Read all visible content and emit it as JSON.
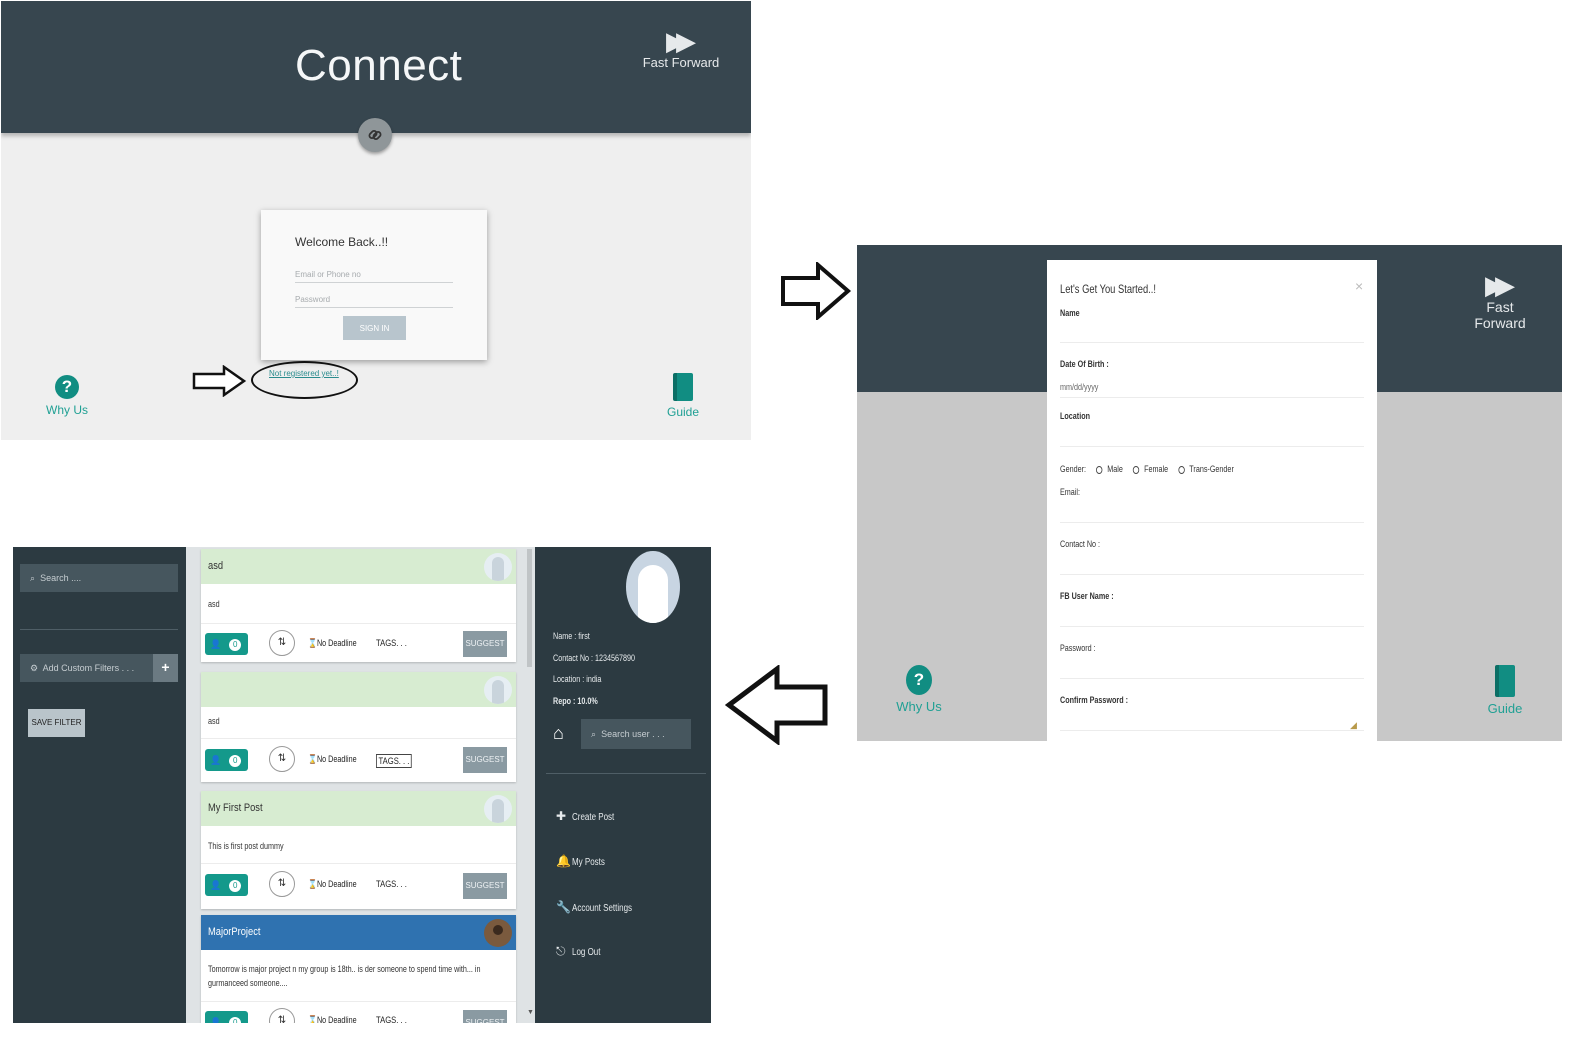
{
  "login": {
    "brand": "Connect",
    "fast_forward": "Fast Forward",
    "welcome": "Welcome Back..!!",
    "email_placeholder": "Email or Phone no",
    "password_placeholder": "Password",
    "signin": "SIGN IN",
    "not_registered": "Not registered yet..!",
    "why_us": "Why Us",
    "guide": "Guide"
  },
  "register": {
    "fast_forward": "Fast Forward",
    "why_us": "Why Us",
    "guide": "Guide",
    "title": "Let's Get You Started..!",
    "close": "×",
    "fields": {
      "name": "Name",
      "dob": "Date Of Birth :",
      "dob_value": "mm/dd/yyyy",
      "location": "Location",
      "gender": "Gender:",
      "gender_options": [
        "Male",
        "Female",
        "Trans-Gender"
      ],
      "email": "Email:",
      "contact": "Contact No :",
      "fb": "FB User Name :",
      "password": "Password :",
      "confirm": "Confirm Password :"
    }
  },
  "dashboard": {
    "left": {
      "search_placeholder": "Search ....",
      "add_filters": "Add Custom Filters . . .",
      "plus": "+",
      "save_filter": "SAVE FILTER"
    },
    "posts": [
      {
        "title": "asd",
        "body": "asd",
        "votes": "0",
        "deadline": "No Deadline",
        "tags": "TAGS. . .",
        "suggest": "SUGGEST"
      },
      {
        "title": "",
        "body": "asd",
        "votes": "0",
        "deadline": "No Deadline",
        "tags": "TAGS. . .",
        "suggest": "SUGGEST"
      },
      {
        "title": "My First Post",
        "body": "This is first post dummy",
        "votes": "0",
        "deadline": "No Deadline",
        "tags": "TAGS. . .",
        "suggest": "SUGGEST"
      },
      {
        "title": "MajorProject",
        "body": "Tomorrow is major project n my group is 18th.. is der someone to spend time with... in gurmanceed someone....",
        "votes": "0",
        "deadline": "No Deadline",
        "tags": "TAGS. . .",
        "suggest": "SUGGEST"
      }
    ],
    "profile": {
      "name": "Name : first",
      "contact": "Contact No : 1234567890",
      "location": "Location : india",
      "repo": "Repo : 10.0%"
    },
    "search_user": "Search user . . .",
    "menu": [
      "Create Post",
      "My Posts",
      "Account Settings",
      "Log Out"
    ]
  }
}
